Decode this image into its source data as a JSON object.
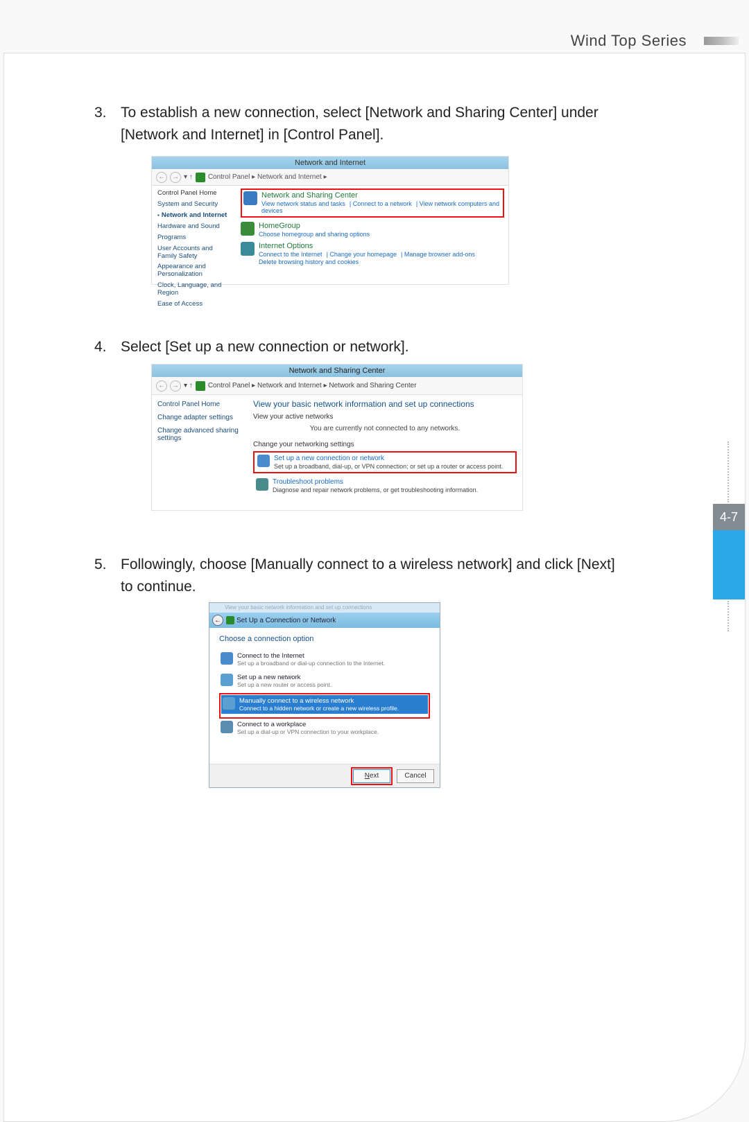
{
  "header": {
    "series": "Wind Top Series"
  },
  "page_number": "4-7",
  "steps": {
    "s3": {
      "num": "3.",
      "text": "To establish a new connection, select [Network and Sharing Center] under [Network and Internet] in [Control Panel]."
    },
    "s4": {
      "num": "4.",
      "text": "Select [Set up a new connection or network]."
    },
    "s5": {
      "num": "5.",
      "text": "Followingly, choose [Manually connect to a wireless network] and click [Next] to continue."
    }
  },
  "shot1": {
    "title": "Network and Internet",
    "breadcrumb": "Control Panel  ▸  Network and Internet  ▸",
    "sidebar": {
      "home": "Control Panel Home",
      "i1": "System and Security",
      "i2": "Network and Internet",
      "i3": "Hardware and Sound",
      "i4": "Programs",
      "i5": "User Accounts and Family Safety",
      "i6": "Appearance and Personalization",
      "i7": "Clock, Language, and Region",
      "i8": "Ease of Access"
    },
    "cat1": {
      "title": "Network and Sharing Center",
      "l1": "View network status and tasks",
      "l2": "Connect to a network",
      "l3": "View network computers and devices"
    },
    "cat2": {
      "title": "HomeGroup",
      "l1": "Choose homegroup and sharing options"
    },
    "cat3": {
      "title": "Internet Options",
      "l1": "Connect to the Internet",
      "l2": "Change your homepage",
      "l3": "Manage browser add-ons",
      "l4": "Delete browsing history and cookies"
    }
  },
  "shot2": {
    "title": "Network and Sharing Center",
    "breadcrumb": "Control Panel  ▸  Network and Internet  ▸  Network and Sharing Center",
    "sidebar": {
      "i1": "Control Panel Home",
      "i2": "Change adapter settings",
      "i3": "Change advanced sharing settings"
    },
    "heading": "View your basic network information and set up connections",
    "sub1": "View your active networks",
    "msg": "You are currently not connected to any networks.",
    "sub2": "Change your networking settings",
    "opt1": {
      "t1": "Set up a new connection or network",
      "t2": "Set up a broadband, dial-up, or VPN connection; or set up a router or access point."
    },
    "opt2": {
      "t1": "Troubleshoot problems",
      "t2": "Diagnose and repair network problems, or get troubleshooting information."
    }
  },
  "shot3": {
    "faint": "View your basic network information and set up connections",
    "title": "Set Up a Connection or Network",
    "heading": "Choose a connection option",
    "opt1": {
      "t1": "Connect to the Internet",
      "t2": "Set up a broadband or dial-up connection to the Internet."
    },
    "opt2": {
      "t1": "Set up a new network",
      "t2": "Set up a new router or access point."
    },
    "opt3": {
      "t1": "Manually connect to a wireless network",
      "t2": "Connect to a hidden network or create a new wireless profile."
    },
    "opt4": {
      "t1": "Connect to a workplace",
      "t2": "Set up a dial-up or VPN connection to your workplace."
    },
    "next": "Next",
    "cancel": "Cancel"
  }
}
